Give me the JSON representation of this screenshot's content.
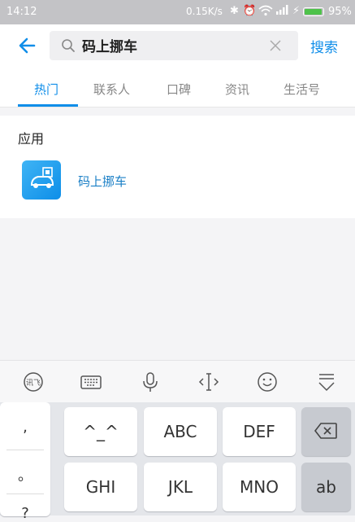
{
  "status": {
    "time": "14:12",
    "net_speed": "0.15K/s",
    "battery": "95%",
    "battery_level": 0.95
  },
  "header": {
    "query": "码上挪车",
    "search_label": "搜索"
  },
  "tabs": [
    "热门",
    "联系人",
    "口碑",
    "资讯",
    "生活号"
  ],
  "active_tab": "热门",
  "section": {
    "title": "应用",
    "app_name": "码上挪车"
  },
  "keyboard": {
    "punct": [
      ",",
      "。",
      "?"
    ],
    "row1": [
      "^_^",
      "ABC",
      "DEF"
    ],
    "row2": [
      "GHI",
      "JKL",
      "MNO",
      "ab"
    ]
  },
  "colors": {
    "accent": "#108ee9",
    "status_bar": "#c3c3c6",
    "battery": "#4ec24a"
  },
  "icons": [
    "back-arrow-icon",
    "search-icon",
    "clear-icon",
    "app-car-icon",
    "input-method-icon",
    "keyboard-icon",
    "microphone-icon",
    "cursor-icon",
    "emoji-icon",
    "hide-keyboard-icon",
    "backspace-icon"
  ]
}
